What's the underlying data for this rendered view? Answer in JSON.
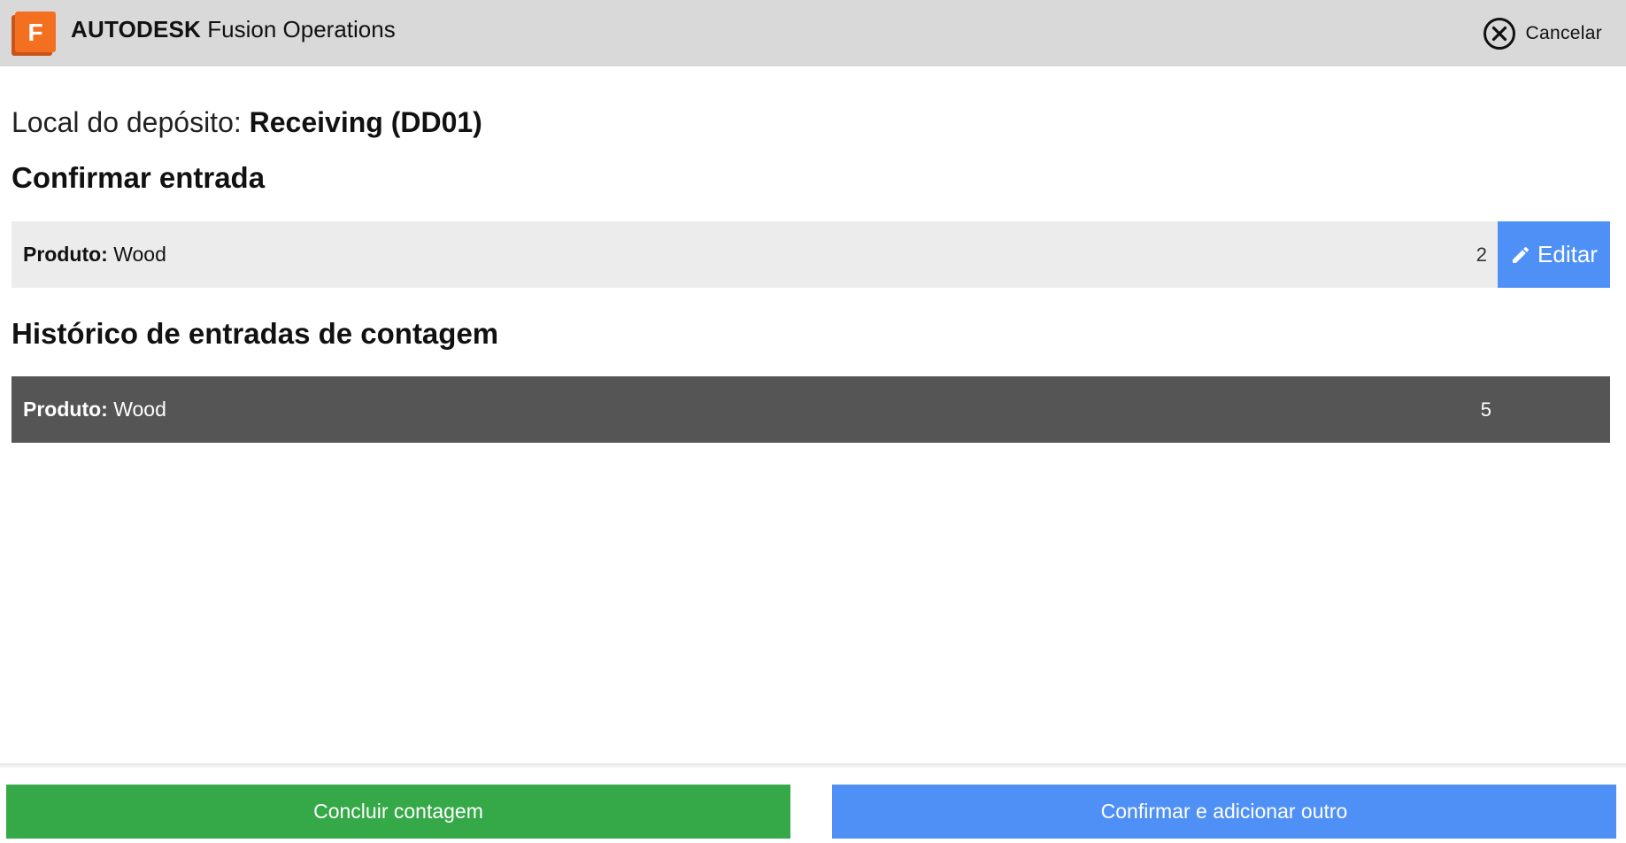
{
  "header": {
    "brand_strong": "AUTODESK",
    "brand_product": "Fusion Operations",
    "logo_letter": "F",
    "logo_icon": "fusion-logo-icon",
    "cancel_label": "Cancelar",
    "cancel_icon": "close-circle-icon"
  },
  "location": {
    "label": "Local do depósito:",
    "value": "Receiving (DD01)"
  },
  "confirm_section": {
    "title": "Confirmar entrada",
    "entry": {
      "product_label": "Produto:",
      "product_value": "Wood",
      "quantity": "2"
    },
    "edit_button": {
      "label": "Editar",
      "icon": "pencil-icon"
    }
  },
  "history_section": {
    "title": "Histórico de entradas de contagem",
    "entries": [
      {
        "product_label": "Produto:",
        "product_value": "Wood",
        "quantity": "5"
      }
    ]
  },
  "footer": {
    "finish_label": "Concluir contagem",
    "confirm_add_label": "Confirmar e adicionar outro"
  },
  "colors": {
    "header_bg": "#d9d9d9",
    "accent_blue": "#4f90f7",
    "accent_green": "#35a847",
    "logo_orange": "#f37021",
    "history_row_bg": "#555555",
    "confirm_row_bg": "#ececec"
  }
}
